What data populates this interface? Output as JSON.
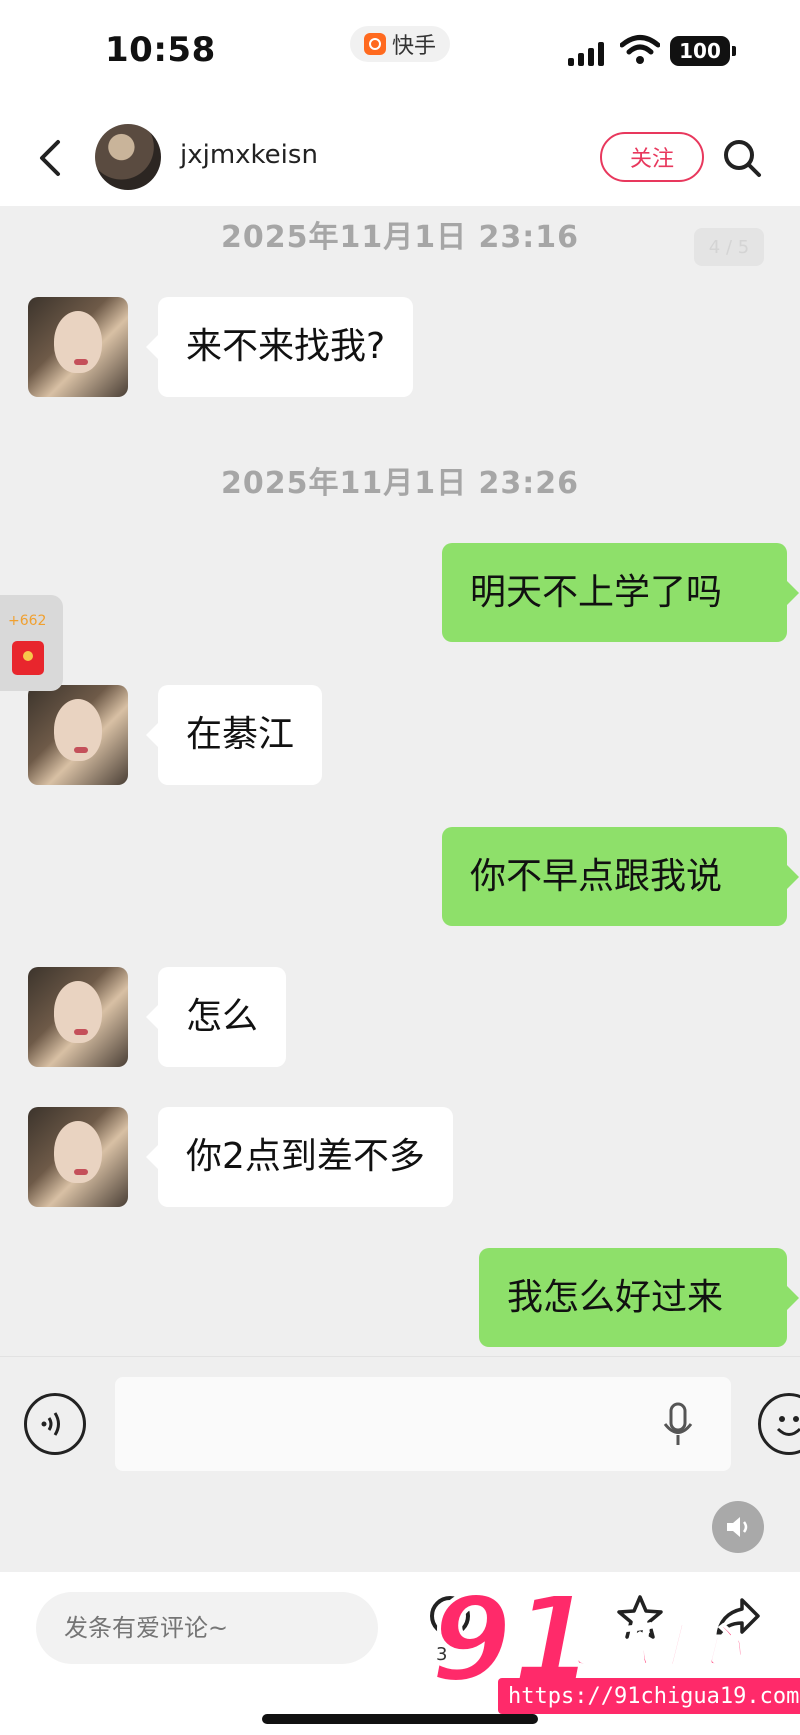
{
  "status_bar": {
    "time": "10:58",
    "app_name": "快手",
    "battery": "100"
  },
  "header": {
    "username": "jxjmxkeisn",
    "follow_label": "关注"
  },
  "chat": {
    "page_indicator": "4 / 5",
    "messages": [
      {
        "type": "timestamp",
        "text": "2025年11月1日 23:16"
      },
      {
        "type": "incoming",
        "text": "来不来找我?"
      },
      {
        "type": "timestamp",
        "text": "2025年11月1日 23:26"
      },
      {
        "type": "outgoing",
        "text": "明天不上学了吗"
      },
      {
        "type": "incoming",
        "text": "在綦江"
      },
      {
        "type": "outgoing",
        "text": "你不早点跟我说"
      },
      {
        "type": "incoming",
        "text": "怎么"
      },
      {
        "type": "incoming",
        "text": "你2点到差不多"
      },
      {
        "type": "outgoing",
        "text": "我怎么好过来"
      }
    ]
  },
  "red_packet": {
    "amount": "+662"
  },
  "comment_bar": {
    "placeholder": "发条有爱评论~",
    "count": "3"
  },
  "watermark": {
    "brand": "91",
    "title": "吃瓜中心",
    "url": "https://91chigua19.com"
  },
  "colors": {
    "outgoing_bubble": "#8ee06a",
    "follow_accent": "#e8385d",
    "background": "#efefef"
  },
  "icons": [
    "back-arrow-icon",
    "search-icon",
    "voice-icon",
    "mic-icon",
    "emoji-icon",
    "speaker-icon",
    "star-icon",
    "share-icon",
    "red-packet-icon"
  ]
}
